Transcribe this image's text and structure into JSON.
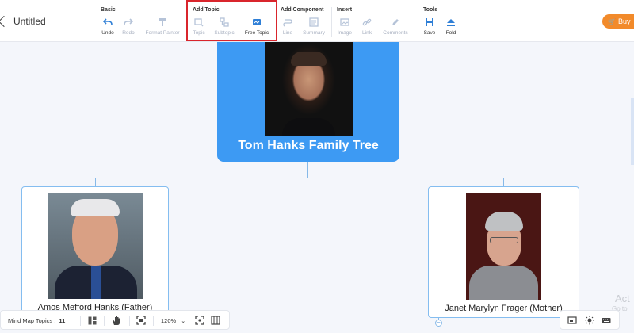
{
  "document": {
    "title": "Untitled"
  },
  "toolbar": {
    "groups": [
      {
        "title": "Basic",
        "tools": [
          {
            "label": "Undo",
            "icon": "undo-icon"
          },
          {
            "label": "Redo",
            "icon": "redo-icon"
          },
          {
            "label": "Format Painter",
            "icon": "format-painter-icon"
          }
        ]
      },
      {
        "title": "Add Topic",
        "tools": [
          {
            "label": "Topic",
            "icon": "topic-icon"
          },
          {
            "label": "Subtopic",
            "icon": "subtopic-icon"
          },
          {
            "label": "Free Topic",
            "icon": "free-topic-icon"
          }
        ]
      },
      {
        "title": "Add Component",
        "tools": [
          {
            "label": "Line",
            "icon": "line-icon"
          },
          {
            "label": "Summary",
            "icon": "summary-icon"
          }
        ]
      },
      {
        "title": "Insert",
        "tools": [
          {
            "label": "Image",
            "icon": "image-icon"
          },
          {
            "label": "Link",
            "icon": "link-icon"
          },
          {
            "label": "Comments",
            "icon": "comments-icon"
          }
        ]
      },
      {
        "title": "Tools",
        "tools": [
          {
            "label": "Save",
            "icon": "save-icon"
          },
          {
            "label": "Fold",
            "icon": "fold-icon"
          }
        ]
      }
    ],
    "buy_label": "Buy"
  },
  "mindmap": {
    "root": {
      "title": "Tom Hanks Family Tree"
    },
    "father": {
      "title": "Amos Mefford Hanks (Father)"
    },
    "mother": {
      "title": "Janet Marylyn Frager (Mother)"
    }
  },
  "watermark": {
    "line1": "Act",
    "line2": "Go to"
  },
  "statusbar": {
    "topics_label": "Mind Map Topics :",
    "topics_count": "11",
    "zoom": "120%"
  },
  "colors": {
    "accent": "#3d9af3",
    "highlight": "#d9252c",
    "buy": "#f28a2a",
    "connector": "#86b9e8"
  }
}
